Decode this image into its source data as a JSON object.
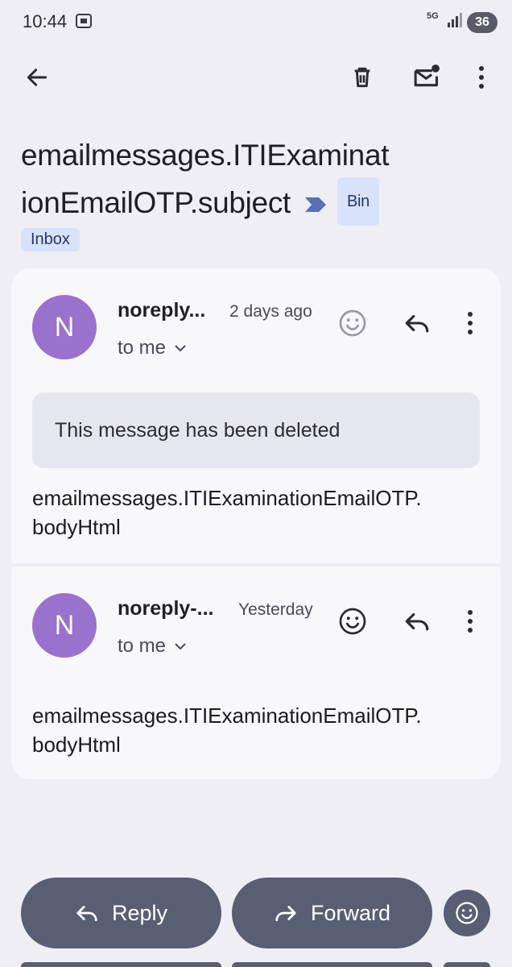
{
  "status_bar": {
    "time": "10:44",
    "network": "5G",
    "battery": "36"
  },
  "toolbar": {
    "back_icon": "arrow-left-icon",
    "delete_icon": "trash-icon",
    "mark_unread_icon": "mail-badge-icon",
    "more_icon": "more-vert-icon"
  },
  "thread": {
    "subject_line1": "emailmessages.ITIExaminat",
    "subject_line2": "ionEmailOTP.subject",
    "labels": [
      "Bin",
      "Inbox"
    ],
    "colors": {
      "label_bg": "#d8e2fb",
      "avatar": "#9a71cc",
      "action_button": "#585f73"
    }
  },
  "messages": [
    {
      "avatar_letter": "N",
      "sender": "noreply...",
      "time": "2 days ago",
      "recipient": "to me",
      "deleted_notice": "This message has been deleted",
      "body": "emailmessages.ITIExaminationEmailOTP.\nbodyHtml"
    },
    {
      "avatar_letter": "N",
      "sender": "noreply-...",
      "time": "Yesterday",
      "recipient": "to me",
      "body": "emailmessages.ITIExaminationEmailOTP.\nbodyHtml"
    }
  ],
  "actions": {
    "reply": "Reply",
    "forward": "Forward",
    "emoji_icon": "smile-icon"
  }
}
